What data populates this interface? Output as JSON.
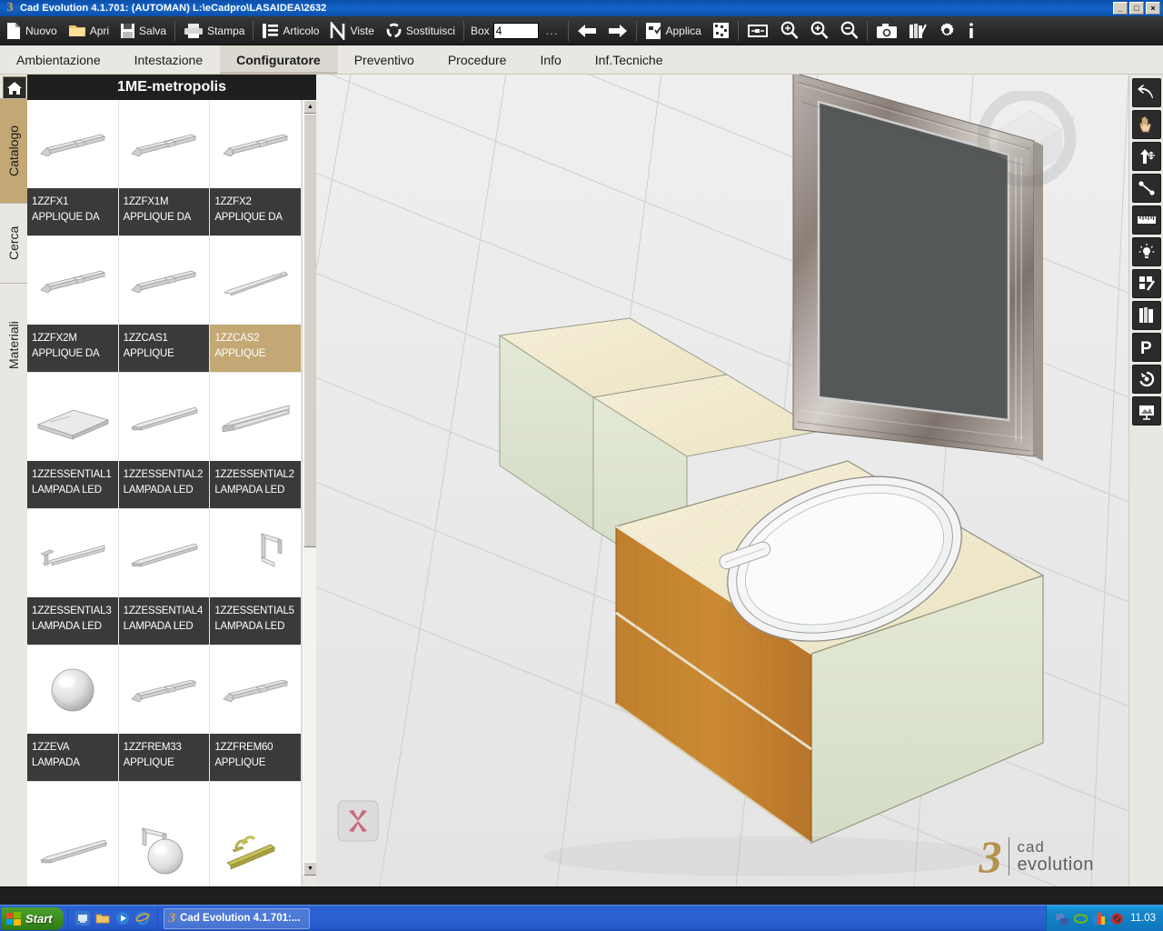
{
  "window": {
    "title": "Cad Evolution 4.1.701: (AUTOMAN)  L:\\eCadpro\\LASAIDEA\\2632",
    "logo_glyph": "3",
    "minimize": "_",
    "maximize": "□",
    "close": "×"
  },
  "toolbar": {
    "items": [
      {
        "label": "Nuovo",
        "icon": "new-document-icon"
      },
      {
        "label": "Apri",
        "icon": "open-folder-icon"
      },
      {
        "label": "Salva",
        "icon": "floppy-disk-icon"
      },
      {
        "label": "Stampa",
        "icon": "printer-icon"
      },
      {
        "label": "Articolo",
        "icon": "list-icon"
      },
      {
        "label": "Viste",
        "icon": "views-icon"
      },
      {
        "label": "Sostituisci",
        "icon": "replace-refresh-icon"
      }
    ],
    "box_label": "Box",
    "box_value": "4",
    "ellipsis": "...",
    "back_icon": "arrow-left-icon",
    "forward_icon": "arrow-right-icon",
    "apply_label": "Applica",
    "apply_icon": "apply-checklist-icon",
    "render_icon": "render-dots-icon",
    "fit_icon": "zoom-fit-icon",
    "zoom_window_icon": "zoom-window-icon",
    "zoom_in_icon": "zoom-in-icon",
    "zoom_out_icon": "zoom-out-icon",
    "camera_icon": "camera-icon",
    "books_icon": "books-pencil-icon",
    "settings_icon": "gear-icon",
    "info_icon": "info-icon"
  },
  "tabs": {
    "items": [
      {
        "label": "Ambientazione",
        "active": false
      },
      {
        "label": "Intestazione",
        "active": false
      },
      {
        "label": "Configuratore",
        "active": true
      },
      {
        "label": "Preventivo",
        "active": false
      },
      {
        "label": "Procedure",
        "active": false
      },
      {
        "label": "Info",
        "active": false
      },
      {
        "label": "Inf.Tecniche",
        "active": false
      }
    ]
  },
  "side_rail": {
    "items": [
      {
        "label": "Catalogo",
        "active": true
      },
      {
        "label": "Cerca",
        "active": false
      },
      {
        "label": "Materiali",
        "active": false
      }
    ]
  },
  "catalog": {
    "home_icon": "home-icon",
    "title": "1ME-metropolis",
    "scroll_up_icon": "scroll-up-arrow-icon",
    "scroll_down_icon": "scroll-down-arrow-icon",
    "items": [
      {
        "code": "1ZZFX1",
        "desc": "APPLIQUE DA",
        "thumb": "bar-light",
        "selected": false
      },
      {
        "code": "1ZZFX1M",
        "desc": "APPLIQUE DA",
        "thumb": "bar-light",
        "selected": false
      },
      {
        "code": "1ZZFX2",
        "desc": "APPLIQUE DA",
        "thumb": "bar-light",
        "selected": false
      },
      {
        "code": "1ZZFX2M",
        "desc": "APPLIQUE DA",
        "thumb": "bar-light",
        "selected": false
      },
      {
        "code": "1ZZCAS1",
        "desc": "APPLIQUE",
        "thumb": "bar-light",
        "selected": false
      },
      {
        "code": "1ZZCAS2",
        "desc": "APPLIQUE",
        "thumb": "thin-bar",
        "selected": true
      },
      {
        "code": "1ZZESSENTIAL1",
        "desc": "LAMPADA LED",
        "thumb": "flat-panel",
        "selected": false
      },
      {
        "code": "1ZZESSENTIAL2",
        "desc": "LAMPADA LED",
        "thumb": "slim-bar",
        "selected": false
      },
      {
        "code": "1ZZESSENTIAL2",
        "desc": "LAMPADA LED",
        "thumb": "channel-bar",
        "selected": false
      },
      {
        "code": "1ZZESSENTIAL3",
        "desc": "LAMPADA LED",
        "thumb": "bracket-bar",
        "selected": false
      },
      {
        "code": "1ZZESSENTIAL4",
        "desc": "LAMPADA LED",
        "thumb": "slim-bar",
        "selected": false
      },
      {
        "code": "1ZZESSENTIAL5",
        "desc": "LAMPADA LED",
        "thumb": "arm-lamp",
        "selected": false
      },
      {
        "code": "1ZZEVA",
        "desc": "LAMPADA",
        "thumb": "sphere",
        "selected": false
      },
      {
        "code": "1ZZFREM33",
        "desc": "APPLIQUE",
        "thumb": "bar-light",
        "selected": false
      },
      {
        "code": "1ZZFREM60",
        "desc": "APPLIQUE",
        "thumb": "bar-light",
        "selected": false
      },
      {
        "code": "",
        "desc": "",
        "thumb": "slim-bar",
        "selected": false
      },
      {
        "code": "",
        "desc": "",
        "thumb": "globe-arm",
        "selected": false
      },
      {
        "code": "",
        "desc": "",
        "thumb": "brass-lamp",
        "selected": false
      }
    ]
  },
  "viewport": {
    "navcube_icon": "view-orientation-cube",
    "axis_widget_icon": "axis-gizmo-icon",
    "watermark": {
      "mark": "3",
      "line1": "cad",
      "line2": "evolution"
    },
    "scene_objects": [
      {
        "name": "vanity-cabinet-left",
        "material": "pale-green-laminate"
      },
      {
        "name": "vanity-cabinet-right",
        "material": "wood-orange"
      },
      {
        "name": "countertop",
        "material": "beige-speckled-stone"
      },
      {
        "name": "oval-washbasin",
        "material": "white-ceramic"
      },
      {
        "name": "mirror-panel",
        "material": "mosaic-frame"
      }
    ]
  },
  "right_rail": {
    "items": [
      {
        "icon": "undo-arrow-icon",
        "label": "Annulla"
      },
      {
        "icon": "hand-pan-icon",
        "label": "Sposta vista"
      },
      {
        "icon": "move-object-icon",
        "label": "Sposta oggetto"
      },
      {
        "icon": "line-tool-icon",
        "label": "Linea"
      },
      {
        "icon": "ruler-icon",
        "label": "Misura"
      },
      {
        "icon": "light-bulb-icon",
        "label": "Luci"
      },
      {
        "icon": "tiles-pencil-icon",
        "label": "Materiali"
      },
      {
        "icon": "books-icon",
        "label": "Librerie"
      },
      {
        "icon": "parking-p-icon",
        "label": "Parametri"
      },
      {
        "icon": "rotate-ccw-icon",
        "label": "Ruota"
      },
      {
        "icon": "present-board-icon",
        "label": "Presentazione"
      }
    ]
  },
  "taskbar": {
    "start_label": "Start",
    "quick_launch": [
      {
        "icon": "show-desktop-icon"
      },
      {
        "icon": "folder-icon"
      },
      {
        "icon": "media-player-icon"
      },
      {
        "icon": "internet-explorer-icon"
      }
    ],
    "task_item": "Cad Evolution 4.1.701:...",
    "task_item_icon": "cad-evolution-icon",
    "tray_icons": [
      {
        "icon": "network-icon"
      },
      {
        "icon": "nvidia-icon"
      },
      {
        "icon": "graphics-icon"
      },
      {
        "icon": "antivirus-blocked-icon"
      }
    ],
    "clock": "11.03"
  },
  "colors": {
    "accent_gold": "#c3a875",
    "toolbar_dark": "#2b2b2b",
    "caption_dark": "#3a3a3a",
    "tab_active": "#dbd8d2",
    "titlebar_blue": "#1464c8",
    "viewport_bg": "#ebebeb",
    "wood": "#c17a2a",
    "counter": "#f2ecd2",
    "cabinet_green": "#dfe6cf"
  }
}
